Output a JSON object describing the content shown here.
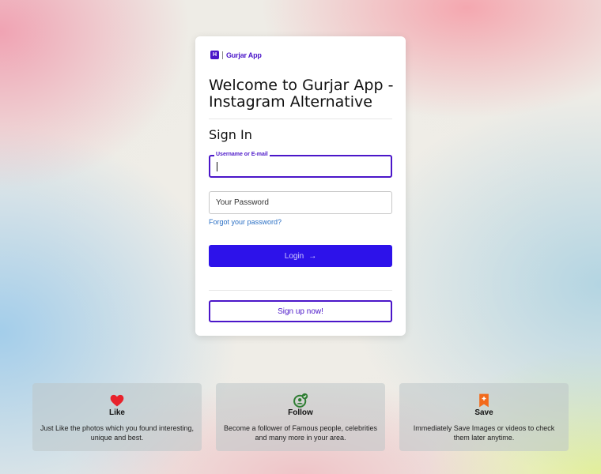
{
  "brand": {
    "name": "Gurjar App",
    "mark": "H",
    "color": "#4b16c9"
  },
  "card": {
    "title": "Welcome to Gurjar App - Instagram Alternative",
    "subtitle": "Sign In"
  },
  "form": {
    "username": {
      "label": "Username or E-mail",
      "value": ""
    },
    "password": {
      "placeholder": "Your Password"
    },
    "forgot_link": "Forgot your password?",
    "login_label": "Login",
    "signup_label": "Sign up now!"
  },
  "features": [
    {
      "icon": "heart-icon",
      "title": "Like",
      "desc": "Just Like the photos which you found interesting, unique and best."
    },
    {
      "icon": "follow-icon",
      "title": "Follow",
      "desc": "Become a follower of Famous people, celebrities and many more in your area."
    },
    {
      "icon": "bookmark-icon",
      "title": "Save",
      "desc": "Immediately Save Images or videos to check them later anytime."
    }
  ],
  "colors": {
    "accent": "#2d12ea",
    "link": "#2a6fc4",
    "like": "#e8222c",
    "follow": "#2e7d32",
    "save": "#f26a1b"
  }
}
